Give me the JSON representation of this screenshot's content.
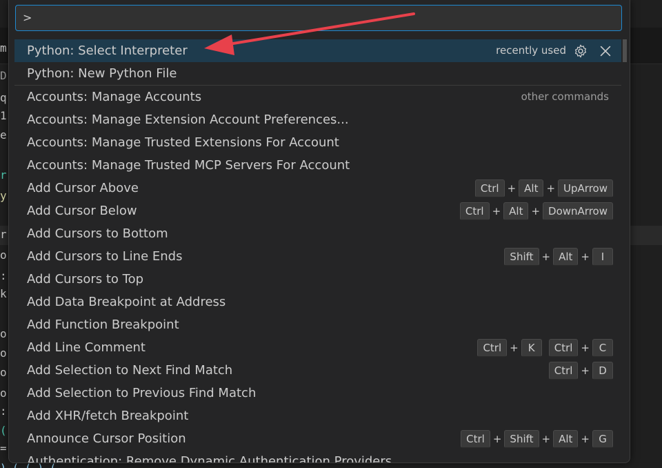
{
  "search": {
    "value": ">"
  },
  "commands": [
    {
      "label": "Python: Select Interpreter",
      "meta": "recently used",
      "selected": true
    },
    {
      "label": "Python: New Python File"
    },
    {
      "label": "Accounts: Manage Accounts",
      "meta": "other commands"
    },
    {
      "label": "Accounts: Manage Extension Account Preferences..."
    },
    {
      "label": "Accounts: Manage Trusted Extensions For Account"
    },
    {
      "label": "Accounts: Manage Trusted MCP Servers For Account"
    },
    {
      "label": "Add Cursor Above",
      "keys": [
        [
          "Ctrl",
          "Alt",
          "UpArrow"
        ]
      ]
    },
    {
      "label": "Add Cursor Below",
      "keys": [
        [
          "Ctrl",
          "Alt",
          "DownArrow"
        ]
      ]
    },
    {
      "label": "Add Cursors to Bottom"
    },
    {
      "label": "Add Cursors to Line Ends",
      "keys": [
        [
          "Shift",
          "Alt",
          "I"
        ]
      ]
    },
    {
      "label": "Add Cursors to Top"
    },
    {
      "label": "Add Data Breakpoint at Address"
    },
    {
      "label": "Add Function Breakpoint"
    },
    {
      "label": "Add Line Comment",
      "keys": [
        [
          "Ctrl",
          "K"
        ],
        [
          "Ctrl",
          "C"
        ]
      ]
    },
    {
      "label": "Add Selection to Next Find Match",
      "keys": [
        [
          "Ctrl",
          "D"
        ]
      ]
    },
    {
      "label": "Add Selection to Previous Find Match"
    },
    {
      "label": "Add XHR/fetch Breakpoint"
    },
    {
      "label": "Announce Cursor Position",
      "keys": [
        [
          "Ctrl",
          "Shift",
          "Alt",
          "G"
        ]
      ]
    },
    {
      "label": "Authentication: Remove Dynamic Authentication Providers"
    }
  ],
  "background_code": {
    "fragments": [
      "m",
      "D",
      "q",
      "1",
      "e",
      "r",
      "y",
      "r",
      "o",
      ":",
      "k",
      "o",
      "o",
      "o",
      "o",
      ":",
      "(",
      "="
    ],
    "bottom_line": "                                    ) (  (  )  ("
  },
  "icons": {
    "configure": "gear-icon",
    "remove": "close-icon"
  },
  "colors": {
    "accent_border": "#1f8ad2",
    "selection": "#1e3b4d",
    "annotation_arrow": "#e8414b"
  }
}
